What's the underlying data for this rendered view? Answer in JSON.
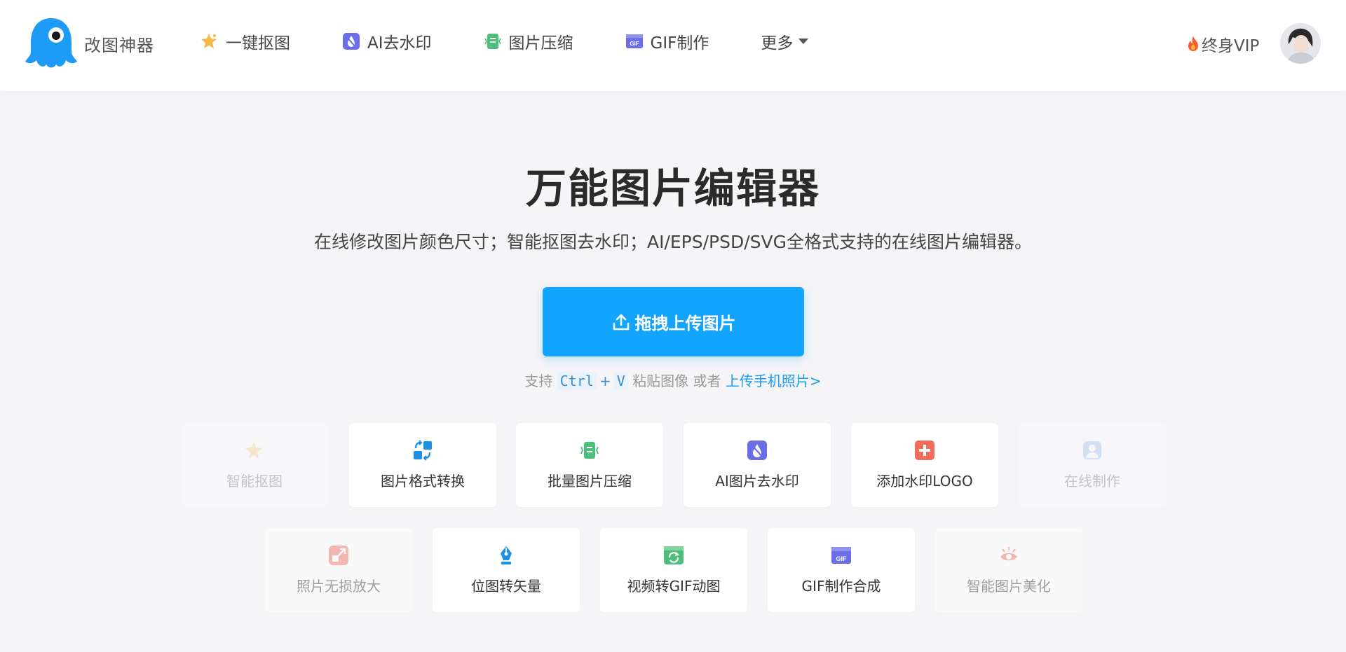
{
  "header": {
    "logo_text": "改图神器",
    "nav": [
      {
        "label": "一键抠图",
        "icon": "star-magic-icon"
      },
      {
        "label": "AI去水印",
        "icon": "water-drop-icon"
      },
      {
        "label": "图片压缩",
        "icon": "compress-icon"
      },
      {
        "label": "GIF制作",
        "icon": "gif-icon"
      },
      {
        "label": "更多",
        "icon": "chevron-down-icon"
      }
    ],
    "vip_label": "终身VIP"
  },
  "hero": {
    "title": "万能图片编辑器",
    "subtitle": "在线修改图片颜色尺寸；智能抠图去水印；AI/EPS/PSD/SVG全格式支持的在线图片编辑器。",
    "upload_label": "拖拽上传图片",
    "hint_support": "支持",
    "hint_key_ctrl": "Ctrl",
    "hint_plus": "+",
    "hint_key_v": "V",
    "hint_paste": "粘贴图像 或者",
    "hint_link": "上传手机照片>"
  },
  "tools_row1": [
    {
      "label": "智能抠图",
      "icon": "star-magic-icon"
    },
    {
      "label": "图片格式转换",
      "icon": "format-convert-icon"
    },
    {
      "label": "批量图片压缩",
      "icon": "compress-icon"
    },
    {
      "label": "AI图片去水印",
      "icon": "water-drop-icon"
    },
    {
      "label": "添加水印LOGO",
      "icon": "add-watermark-icon"
    },
    {
      "label": "在线制作",
      "icon": "portrait-icon"
    }
  ],
  "tools_row2": [
    {
      "label": "照片无损放大",
      "icon": "enlarge-icon"
    },
    {
      "label": "位图转矢量",
      "icon": "pen-nib-icon"
    },
    {
      "label": "视频转GIF动图",
      "icon": "video-gif-icon"
    },
    {
      "label": "GIF制作合成",
      "icon": "gif-icon"
    },
    {
      "label": "智能图片美化",
      "icon": "eye-beauty-icon"
    }
  ],
  "colors": {
    "primary": "#12a4ff",
    "logo": "#1e9bf7",
    "link": "#1a9bf0"
  }
}
